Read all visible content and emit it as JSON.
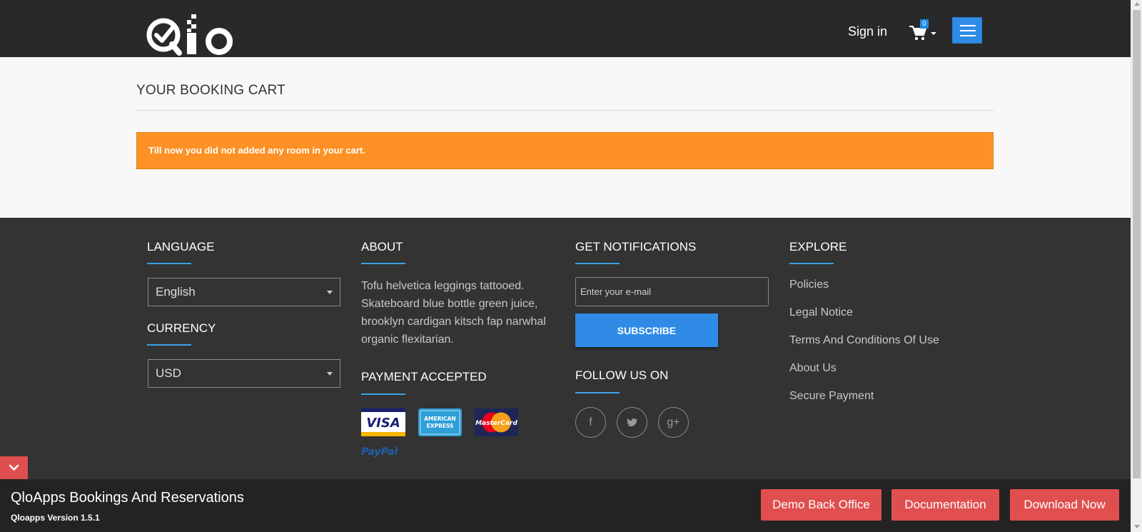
{
  "header": {
    "signin_label": "Sign in",
    "cart_count": "0"
  },
  "main": {
    "heading": "YOUR BOOKING CART",
    "alert": "Till now you did not added any room in your cart."
  },
  "footer": {
    "language": {
      "title": "LANGUAGE",
      "selected": "English"
    },
    "currency": {
      "title": "CURRENCY",
      "selected": "USD"
    },
    "about": {
      "title": "ABOUT",
      "text": "Tofu helvetica leggings tattooed. Skateboard blue bottle green juice, brooklyn cardigan kitsch fap narwhal organic flexitarian."
    },
    "payment": {
      "title": "PAYMENT ACCEPTED",
      "methods": [
        "VISA",
        "AMERICAN EXPRESS",
        "MasterCard",
        "PayPal"
      ]
    },
    "notifications": {
      "title": "GET NOTIFICATIONS",
      "email_placeholder": "Enter your e-mail",
      "subscribe_label": "SUBSCRIBE"
    },
    "follow": {
      "title": "FOLLOW US ON",
      "icons": [
        "f",
        "twitter",
        "g+"
      ]
    },
    "explore": {
      "title": "EXPLORE",
      "links": [
        "Policies",
        "Legal Notice",
        "Terms And Conditions Of Use",
        "About Us",
        "Secure Payment"
      ]
    }
  },
  "bottom_bar": {
    "title": "QloApps Bookings And Reservations",
    "version": "Qloapps Version 1.5.1",
    "buttons": [
      "Demo Back Office",
      "Documentation",
      "Download Now"
    ]
  },
  "colors": {
    "header_bg": "#292929",
    "alert_bg": "#fe9126",
    "accent_blue": "#2f8be6",
    "footer_bg": "#333333",
    "bottom_bar_bg": "#232323",
    "button_red": "#e04f4f"
  }
}
